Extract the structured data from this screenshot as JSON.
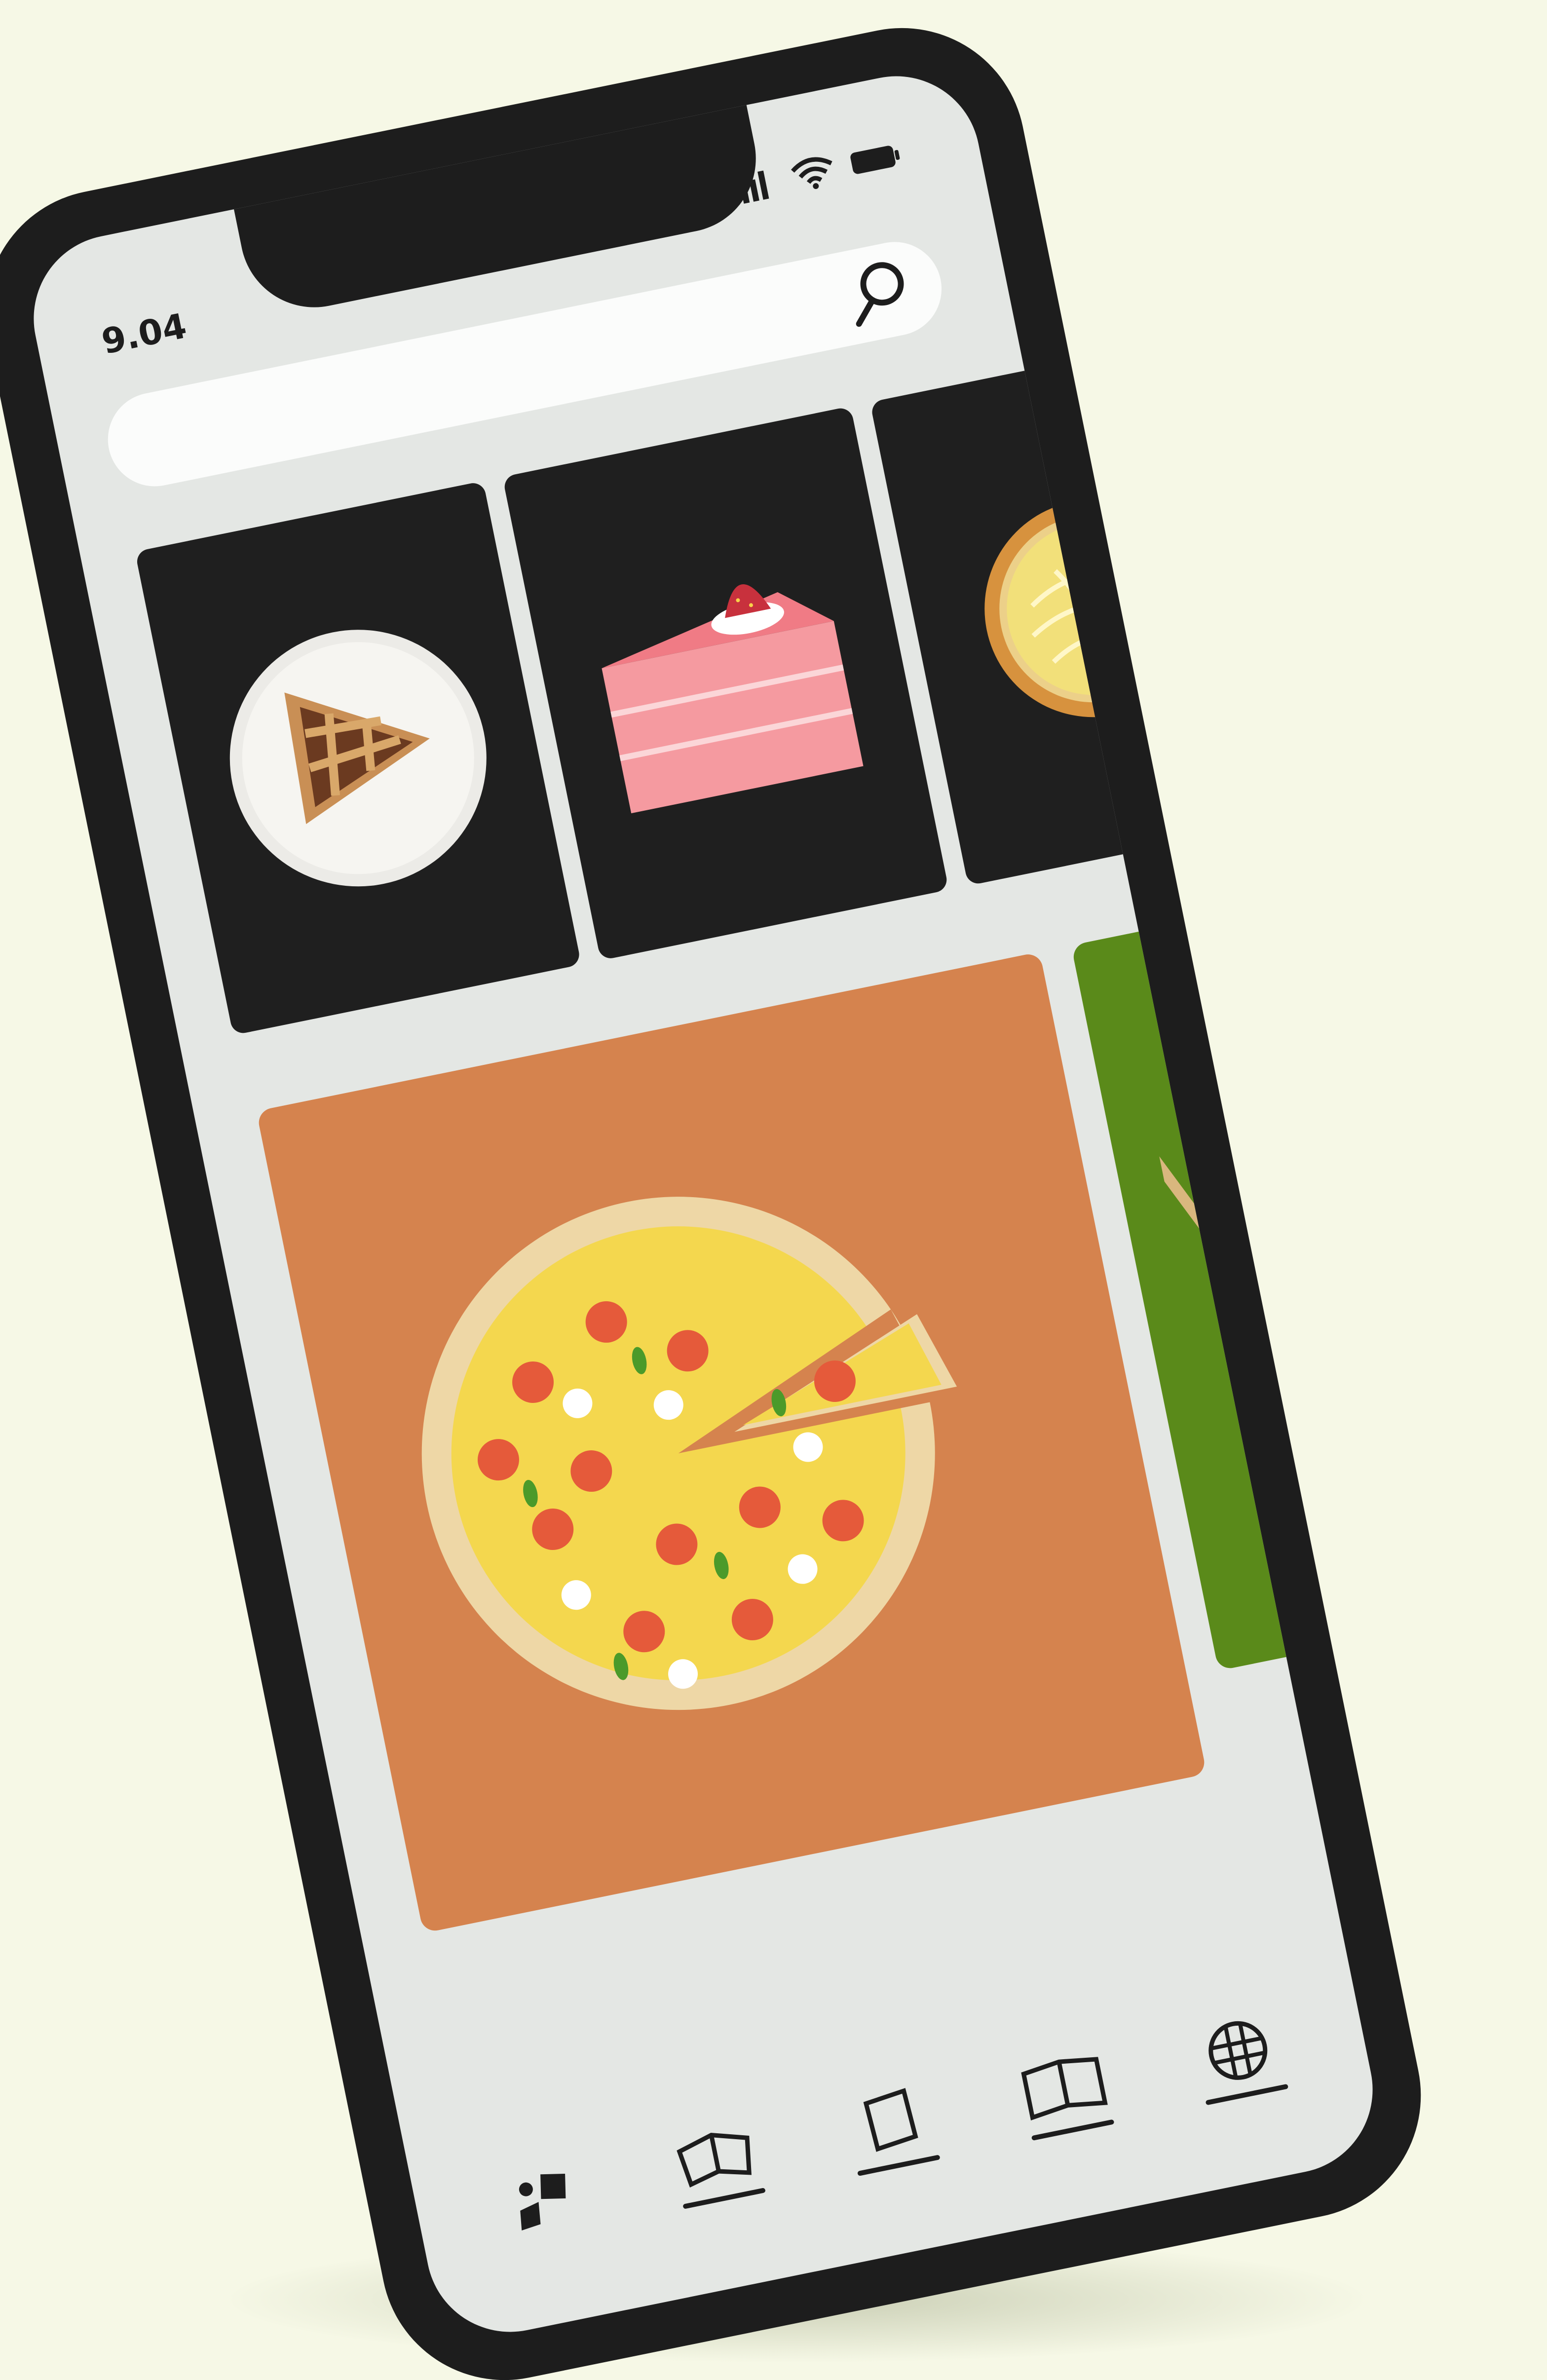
{
  "status_bar": {
    "time": "9.04"
  },
  "search": {
    "placeholder": ""
  },
  "categories": [
    {
      "name": "pie-slice"
    },
    {
      "name": "strawberry-cake"
    },
    {
      "name": "tart"
    }
  ],
  "featured": [
    {
      "name": "pizza",
      "color": "#d5834e"
    },
    {
      "name": "chocolate-ice-cream",
      "color": "#5a8a1a"
    }
  ],
  "tabs": [
    {
      "icon": "dots-icon"
    },
    {
      "icon": "open-book-icon"
    },
    {
      "icon": "note-icon"
    },
    {
      "icon": "book-icon"
    },
    {
      "icon": "globe-icon"
    }
  ],
  "colors": {
    "phone_frame": "#1d1d1d",
    "screen": "#e4e7e4",
    "background": "#f6f8e6"
  }
}
